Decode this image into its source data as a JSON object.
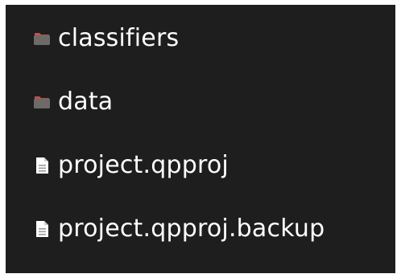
{
  "file_list": {
    "items": [
      {
        "name": "classifiers",
        "type": "folder",
        "icon": "folder-icon"
      },
      {
        "name": "data",
        "type": "folder",
        "icon": "folder-icon"
      },
      {
        "name": "project.qpproj",
        "type": "file",
        "icon": "file-icon"
      },
      {
        "name": "project.qpproj.backup",
        "type": "file",
        "icon": "file-icon"
      }
    ]
  },
  "colors": {
    "background": "#1e1e1e",
    "text": "#ffffff",
    "folder_body": "#6e6a68",
    "folder_tab": "#c0504d",
    "file_body": "#ffffff",
    "file_lines": "#9a9a9a"
  }
}
